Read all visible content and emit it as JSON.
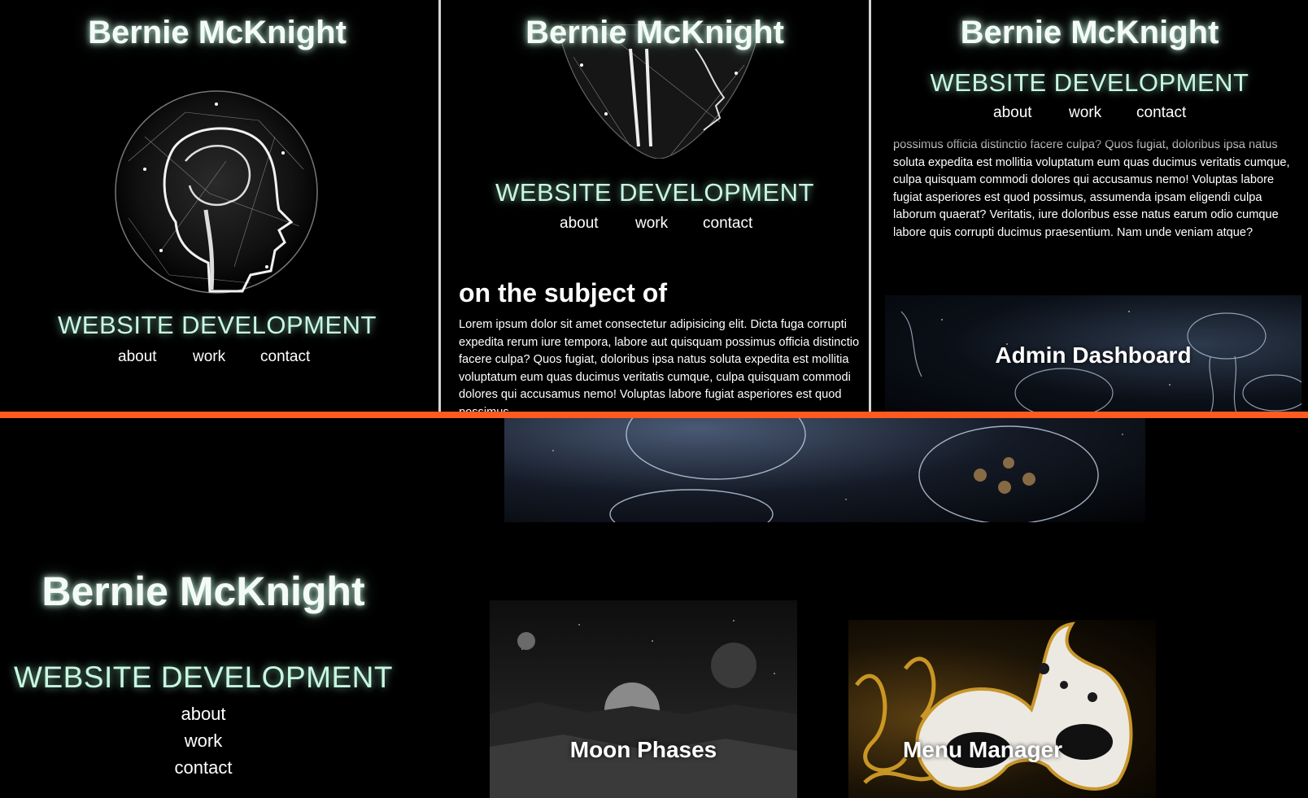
{
  "site": {
    "name": "Bernie McKnight",
    "tagline": "WEBSITE DEVELOPMENT",
    "nav": [
      "about",
      "work",
      "contact"
    ]
  },
  "content": {
    "heading": "on the subject of",
    "paragraph_mid": "Lorem ipsum dolor sit amet consectetur adipisicing elit. Dicta fuga corrupti expedita rerum iure tempora, labore aut quisquam possimus officia distinctio facere culpa? Quos fugiat, doloribus ipsa natus soluta expedita est mollitia voluptatum eum quas ducimus veritatis cumque, culpa quisquam commodi dolores qui accusamus nemo! Voluptas labore fugiat asperiores est quod possimus,",
    "paragraph_right": "possimus officia distinctio facere culpa? Quos fugiat, doloribus ipsa natus soluta expedita est mollitia voluptatum eum quas ducimus veritatis cumque, culpa quisquam commodi dolores qui accusamus nemo! Voluptas labore fugiat asperiores est quod possimus, assumenda ipsam eligendi culpa laborum quaerat? Veritatis, iure doloribus esse natus earum odio cumque labore quis corrupti ducimus praesentium. Nam unde veniam atque?"
  },
  "projects": {
    "admin_dashboard": "Admin Dashboard",
    "moon_phases": "Moon Phases",
    "menu_manager": "Menu Manager"
  },
  "colors": {
    "background": "#000000",
    "accent_divider": "#ff5a1f",
    "glow": "#c8f7e2"
  }
}
